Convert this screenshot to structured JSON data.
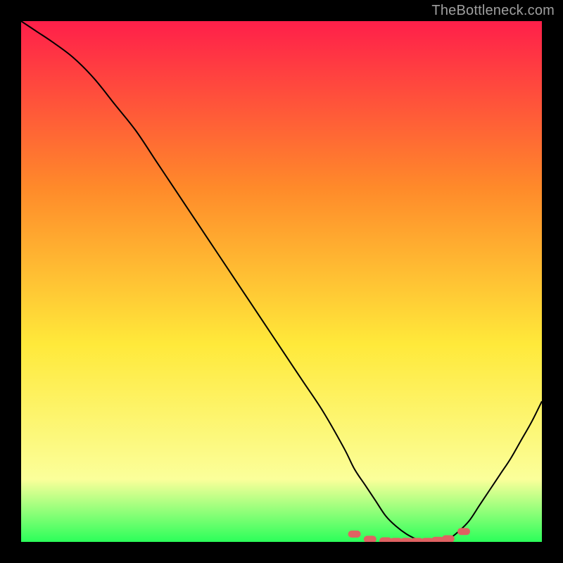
{
  "attribution": "TheBottleneck.com",
  "chart_data": {
    "type": "line",
    "title": "",
    "xlabel": "",
    "ylabel": "",
    "xlim": [
      0,
      100
    ],
    "ylim": [
      0,
      100
    ],
    "grid": false,
    "gradient_colors": {
      "top": "#ff1f4a",
      "mid_upper": "#ff8a2a",
      "mid": "#ffe93a",
      "lower": "#fbff9a",
      "bottom": "#2bff5a"
    },
    "series": [
      {
        "name": "bottleneck-curve",
        "color": "#000000",
        "x": [
          0,
          3,
          6,
          10,
          14,
          18,
          22,
          26,
          30,
          34,
          38,
          42,
          46,
          50,
          54,
          58,
          62,
          64,
          66,
          68,
          70,
          72,
          74,
          76,
          78,
          80,
          82,
          84,
          86,
          88,
          90,
          92,
          94,
          96,
          98,
          100
        ],
        "y": [
          100,
          98,
          96,
          93,
          89,
          84,
          79,
          73,
          67,
          61,
          55,
          49,
          43,
          37,
          31,
          25,
          18,
          14,
          11,
          8,
          5,
          3,
          1.5,
          0.5,
          0,
          0,
          0.5,
          2,
          4,
          7,
          10,
          13,
          16,
          19.5,
          23,
          27
        ]
      }
    ],
    "markers": {
      "name": "highlight-dots",
      "color": "#e06262",
      "x": [
        64,
        67,
        70,
        72,
        74,
        76,
        78,
        80,
        82,
        85
      ],
      "y": [
        1.5,
        0.5,
        0.2,
        0.1,
        0.1,
        0.1,
        0.1,
        0.3,
        0.6,
        2
      ]
    }
  }
}
